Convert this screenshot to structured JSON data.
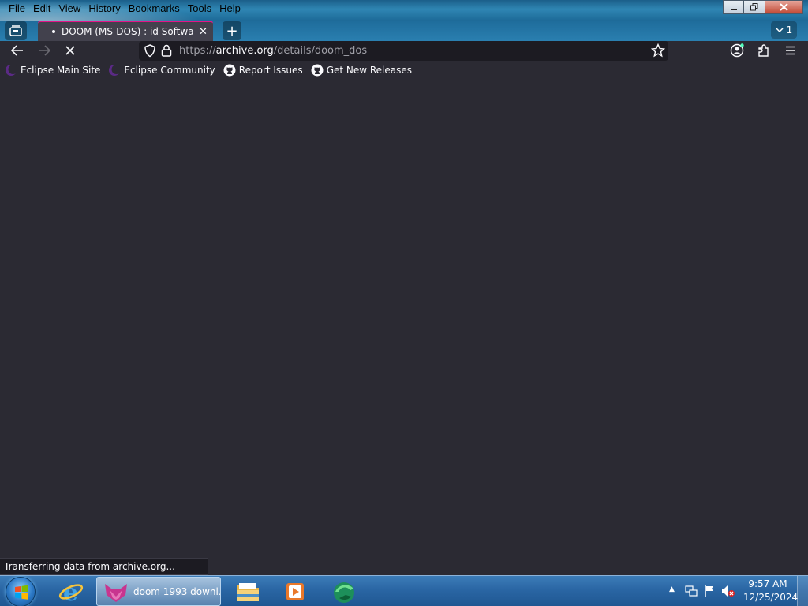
{
  "menubar": {
    "items": [
      "File",
      "Edit",
      "View",
      "History",
      "Bookmarks",
      "Tools",
      "Help"
    ]
  },
  "window_controls": {
    "minimize": "minimize-icon",
    "restore": "restore-icon",
    "close": "close-icon"
  },
  "tabs": {
    "active": {
      "title": "DOOM (MS-DOS) : id Software :",
      "close_icon": "close-icon"
    },
    "count_label": "1"
  },
  "navbar": {
    "url_scheme": "https://",
    "url_host": "archive.org",
    "url_path": "/details/doom_dos",
    "loading": true
  },
  "bookmarks": [
    {
      "label": "Eclipse Main Site",
      "icon": "eclipse-icon"
    },
    {
      "label": "Eclipse Community",
      "icon": "eclipse-icon"
    },
    {
      "label": "Report Issues",
      "icon": "github-icon"
    },
    {
      "label": "Get New Releases",
      "icon": "github-icon"
    }
  ],
  "status_bar": {
    "text": "Transferring data from archive.org..."
  },
  "taskbar": {
    "active_window_label": "doom 1993 downl...",
    "clock_time": "9:57 AM",
    "clock_date": "12/25/2024"
  },
  "colors": {
    "accent_tab": "#e31587",
    "content_bg": "#2b2a33",
    "urlbar_bg": "#1c1b22"
  }
}
